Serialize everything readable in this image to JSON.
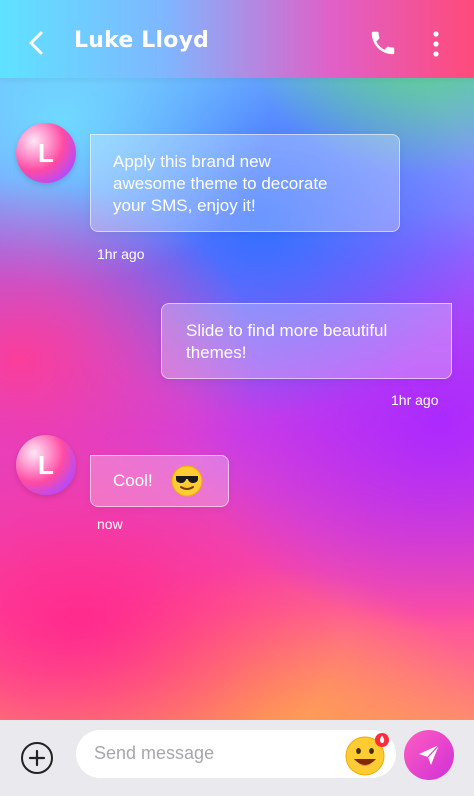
{
  "header": {
    "title": "Luke Lloyd",
    "back_icon": "chevron-left-icon",
    "call_icon": "phone-icon",
    "menu_icon": "more-vertical-icon"
  },
  "messages": [
    {
      "direction": "incoming",
      "avatar_letter": "L",
      "text_lines": [
        "Apply this brand new",
        "awesome theme to decorate",
        "your SMS, enjoy it!"
      ],
      "time": "1hr ago"
    },
    {
      "direction": "outgoing",
      "text_lines": [
        "Slide to find more beautiful",
        "themes!"
      ],
      "time": "1hr ago"
    },
    {
      "direction": "incoming",
      "avatar_letter": "L",
      "text": "Cool!",
      "emoji": "sunglasses-emoji",
      "time": "now"
    }
  ],
  "composer": {
    "placeholder": "Send message",
    "add_icon": "plus-circle-icon",
    "emoji_icon": "grinning-emoji-icon",
    "send_icon": "send-icon"
  },
  "colors": {
    "send_button": "#e43ccf",
    "composer_bg": "#e9e9ee"
  }
}
